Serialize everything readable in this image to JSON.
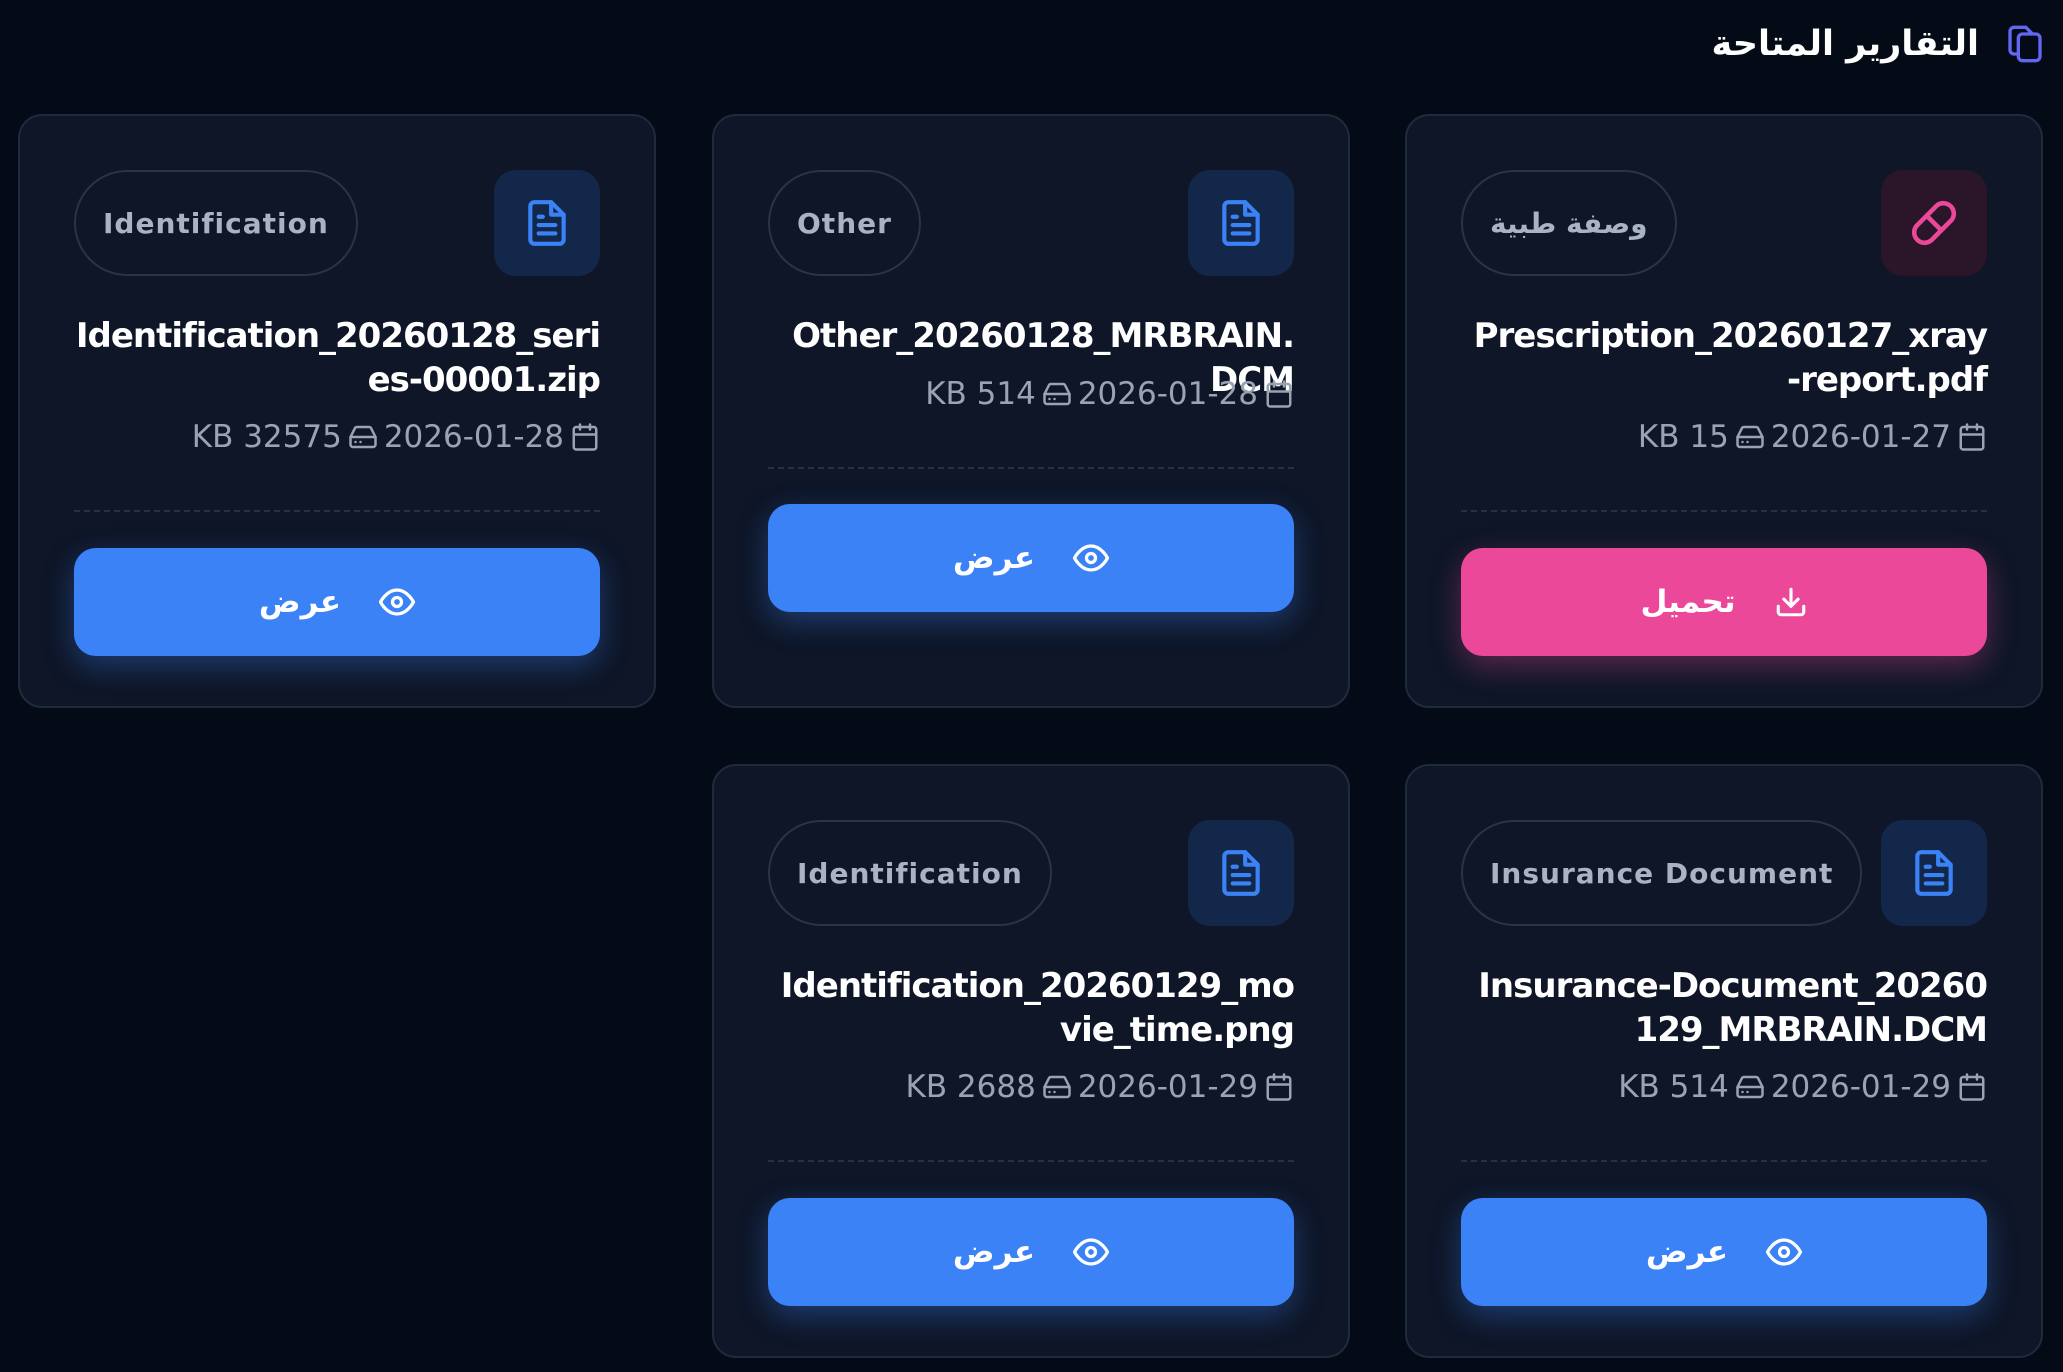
{
  "header": {
    "title": "التقارير المتاحة",
    "icon": "copy-icon"
  },
  "colors": {
    "background": "#050b16",
    "card": "#0e1627",
    "primary_button": "#3b82f6",
    "download_button": "#ec4899",
    "icon_blue": "#3b82f6",
    "icon_pink": "#ec4899",
    "header_icon": "#6366f1"
  },
  "cards": [
    {
      "category": "وصفة طبية",
      "icon": "pill-icon",
      "file_name": "Prescription_20260127_xray-report.pdf",
      "date": "2026-01-27",
      "size": "KB 15",
      "button_label": "تحميل",
      "button_icon": "download-icon"
    },
    {
      "category": "Other",
      "icon": "document-icon",
      "file_name": "Other_20260128_MRBRAIN.DCM",
      "date": "2026-01-28",
      "size": "KB 514",
      "button_label": "عرض",
      "button_icon": "eye-icon"
    },
    {
      "category": "Identification",
      "icon": "document-icon",
      "file_name": "Identification_20260128_series-00001.zip",
      "date": "2026-01-28",
      "size": "KB 32575",
      "button_label": "عرض",
      "button_icon": "eye-icon"
    },
    {
      "category": "Insurance Document",
      "icon": "document-icon",
      "file_name": "Insurance-Document_20260129_MRBRAIN.DCM",
      "date": "2026-01-29",
      "size": "KB 514",
      "button_label": "عرض",
      "button_icon": "eye-icon"
    },
    {
      "category": "Identification",
      "icon": "document-icon",
      "file_name": "Identification_20260129_movie_time.png",
      "date": "2026-01-29",
      "size": "KB 2688",
      "button_label": "عرض",
      "button_icon": "eye-icon"
    }
  ]
}
